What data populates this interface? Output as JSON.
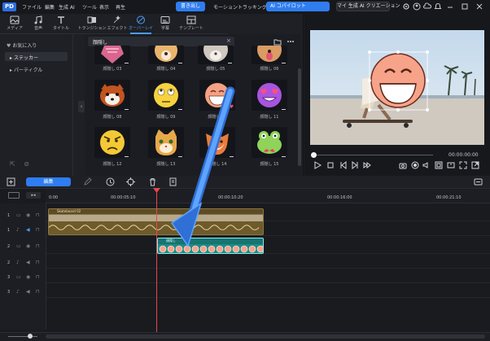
{
  "titlebar": {
    "logo": "PD",
    "menu": [
      "ファイル",
      "編集",
      "生成 AI",
      "ツール",
      "表示",
      "再生"
    ],
    "export_label": "書き出し",
    "doc_title": "モーショントラッキング01（イラスト）",
    "ai_copilot_label": "AI コパイロット",
    "my_ai_label": "マイ 生成 AI クリエーション"
  },
  "tabs": [
    {
      "label": "メディア",
      "icon": "media-icon"
    },
    {
      "label": "音声",
      "icon": "music-icon"
    },
    {
      "label": "タイトル",
      "icon": "title-icon"
    },
    {
      "label": "トランジション",
      "icon": "transition-icon"
    },
    {
      "label": "エフェクト",
      "icon": "effect-icon"
    },
    {
      "label": "オーバーレイ",
      "icon": "overlay-icon",
      "active": true
    },
    {
      "label": "字幕",
      "icon": "subtitle-icon"
    },
    {
      "label": "テンプレート",
      "icon": "template-icon"
    }
  ],
  "sidebar": {
    "items": [
      {
        "label": "お気に入り",
        "icon": "heart-icon"
      },
      {
        "label": "ステッカー",
        "selected": true
      },
      {
        "label": "パーティクル"
      }
    ]
  },
  "search": {
    "value": "顔隠し"
  },
  "stickers": [
    {
      "label": "顔隠し 03",
      "kind": "partial-pink"
    },
    {
      "label": "顔隠し 04",
      "kind": "partial-dog"
    },
    {
      "label": "顔隠し 05",
      "kind": "partial-cat"
    },
    {
      "label": "顔隠し 06",
      "kind": "partial-dog2"
    },
    {
      "label": "顔隠し 08",
      "kind": "red-panda"
    },
    {
      "label": "顔隠し 09",
      "kind": "rolling-eyes"
    },
    {
      "label": "顔隠し 10",
      "kind": "big-smile",
      "favorite": true
    },
    {
      "label": "顔隠し 11",
      "kind": "heart-eyes"
    },
    {
      "label": "顔隠し 12",
      "kind": "angry"
    },
    {
      "label": "顔隠し 13",
      "kind": "cat"
    },
    {
      "label": "顔隠し 14",
      "kind": "fox"
    },
    {
      "label": "顔隠し 15",
      "kind": "frog"
    }
  ],
  "preview": {
    "timecode": "00:00:00:00"
  },
  "timeline": {
    "edit_label": "編集",
    "ruler": [
      "0:00",
      "00:00:05:10",
      "00:00:10:20",
      "00:00:16:00",
      "00:00:21:10"
    ],
    "tracks": [
      "1",
      "1",
      "2",
      "2",
      "3",
      "3"
    ],
    "video_clip_name": "Skateboard 02",
    "sticker_clip_name": "顔隠し"
  }
}
